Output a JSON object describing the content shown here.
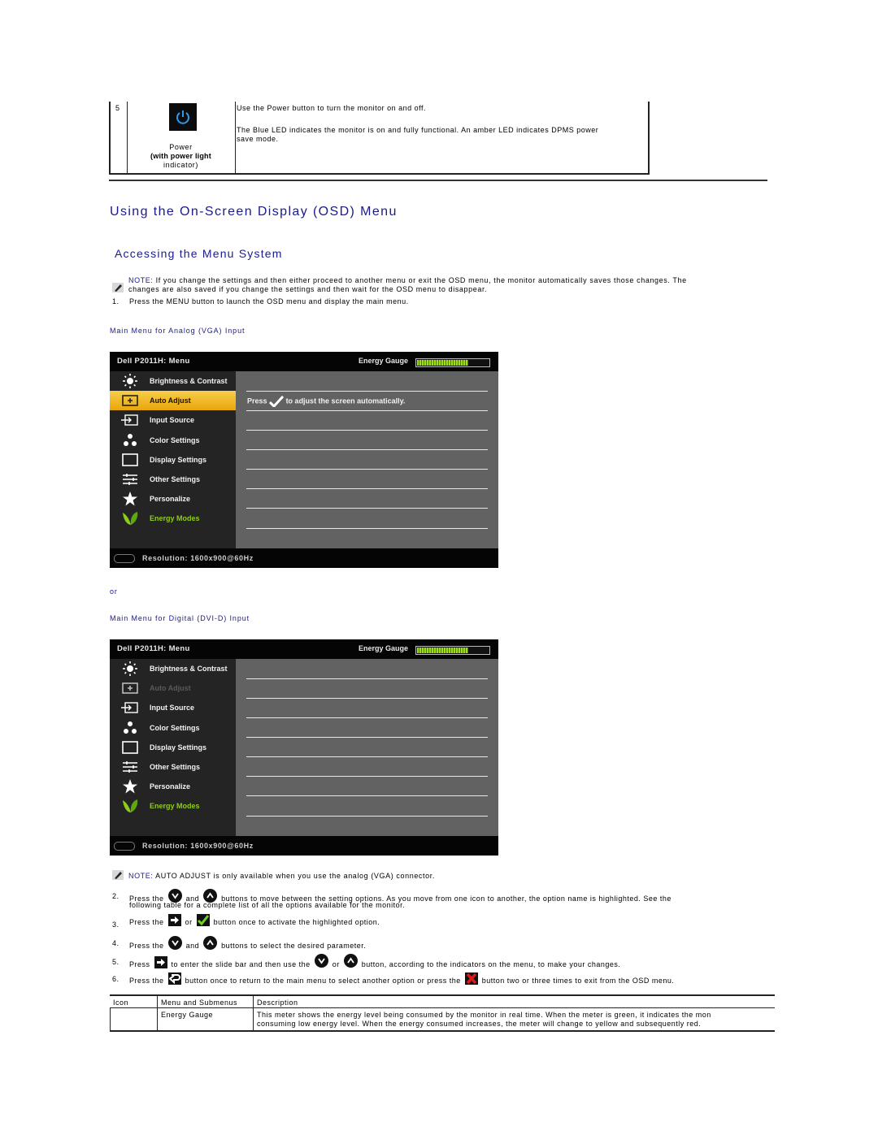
{
  "top_table": {
    "row_number": "5",
    "icon": "power-icon",
    "label_line1": "Power",
    "label_line2": "(with power light",
    "label_line3": "indicator)",
    "desc1": "Use the Power button to turn the monitor on and off.",
    "desc2": "The Blue LED indicates the monitor is on and fully functional. An amber LED indicates DPMS power",
    "desc3": "save mode."
  },
  "section_title": "Using the On-Screen Display (OSD) Menu",
  "subsection_title": "Accessing the Menu System",
  "note1": {
    "prefix": "NOTE:",
    "line1": " If you change the settings and then either proceed to another menu or exit the OSD menu, the monitor automatically saves those changes. The",
    "line2": "changes are also saved if you change the settings and then wait for the OSD menu to disappear."
  },
  "step1": {
    "num": "1.",
    "text": "Press the MENU button to launch the OSD menu and display the main menu."
  },
  "caption_analog": "Main Menu for Analog (VGA) Input",
  "or_text": "or",
  "caption_digital": "Main Menu for Digital (DVI-D) Input",
  "osd_analog": {
    "title": "Dell P2011H: Menu",
    "energy_label": "Energy Gauge",
    "energy_level": 0.72,
    "items": [
      {
        "label": "Brightness & Contrast",
        "icon": "brightness-icon",
        "state": "normal"
      },
      {
        "label": "Auto Adjust",
        "icon": "auto-adjust-icon",
        "state": "selected"
      },
      {
        "label": "Input Source",
        "icon": "input-source-icon",
        "state": "normal"
      },
      {
        "label": "Color Settings",
        "icon": "color-settings-icon",
        "state": "normal"
      },
      {
        "label": "Display Settings",
        "icon": "display-settings-icon",
        "state": "normal"
      },
      {
        "label": "Other Settings",
        "icon": "other-settings-icon",
        "state": "normal"
      },
      {
        "label": "Personalize",
        "icon": "star-icon",
        "state": "normal"
      },
      {
        "label": "Energy Modes",
        "icon": "leaf-icon",
        "state": "green"
      }
    ],
    "press_text_before": "Press",
    "press_text_after": "to adjust the screen automatically.",
    "resolution": "Resolution: 1600x900@60Hz"
  },
  "osd_digital": {
    "title": "Dell P2011H: Menu",
    "energy_label": "Energy Gauge",
    "energy_level": 0.72,
    "items": [
      {
        "label": "Brightness & Contrast",
        "icon": "brightness-icon",
        "state": "normal"
      },
      {
        "label": "Auto Adjust",
        "icon": "auto-adjust-icon",
        "state": "disabled"
      },
      {
        "label": "Input Source",
        "icon": "input-source-icon",
        "state": "normal"
      },
      {
        "label": "Color Settings",
        "icon": "color-settings-icon",
        "state": "normal"
      },
      {
        "label": "Display Settings",
        "icon": "display-settings-icon",
        "state": "normal"
      },
      {
        "label": "Other Settings",
        "icon": "other-settings-icon",
        "state": "normal"
      },
      {
        "label": "Personalize",
        "icon": "star-icon",
        "state": "normal"
      },
      {
        "label": "Energy Modes",
        "icon": "leaf-icon",
        "state": "green"
      }
    ],
    "resolution": "Resolution: 1600x900@60Hz"
  },
  "note2": {
    "prefix": "NOTE:",
    "text": " AUTO ADJUST is only available when you use the analog (VGA) connector."
  },
  "steps": [
    {
      "num": "2.",
      "a": "Press the",
      "b": "and",
      "c": "buttons to move between the setting options. As you move from one icon to another, the option name is highlighted. See the",
      "d": "following table for a complete list of all the options available for the monitor."
    },
    {
      "num": "3.",
      "a": "Press the",
      "b": "or",
      "c": "button once to activate the highlighted option."
    },
    {
      "num": "4.",
      "a": "Press the",
      "b": "and",
      "c": "buttons to select the desired parameter."
    },
    {
      "num": "5.",
      "a": "Press",
      "b": "to enter the slide bar and then use the",
      "c": "or",
      "d": "button, according to the indicators on the menu, to make your changes."
    },
    {
      "num": "6.",
      "a": "Press the",
      "b": "button once to return to the main menu to select another option or press the",
      "c": "button two or three times to exit from the OSD menu."
    }
  ],
  "options_table": {
    "headers": [
      "Icon",
      "Menu and Submenus",
      "Description"
    ],
    "rows": [
      {
        "icon": "",
        "menu": "Energy Gauge",
        "desc1": "This meter shows the energy level being consumed by the monitor in real time. When the meter is green, it indicates the mon",
        "desc2": "consuming low energy level. When the energy consumed increases, the meter will change to yellow and subsequently red."
      }
    ]
  },
  "colors": {
    "heading_blue": "#1a1a8c",
    "osd_highlight": "#f0b520",
    "energy_green": "#8dcc1a",
    "power_blue": "#2a9bf0"
  }
}
